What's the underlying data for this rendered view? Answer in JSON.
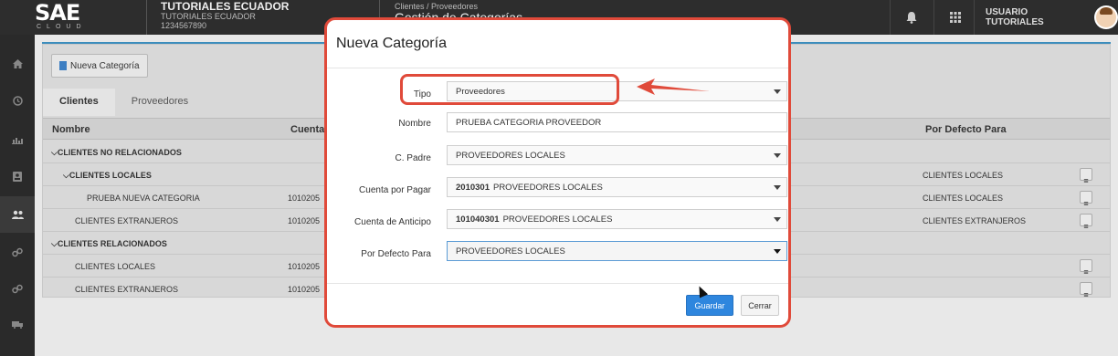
{
  "topbar": {
    "logo_main": "SAE",
    "logo_sub": "CLOUD",
    "company_name": "TUTORIALES ECUADOR",
    "company_sub": "TUTORIALES ECUADOR",
    "company_ruc": "1234567890",
    "breadcrumb": "Clientes / Proveedores",
    "page_title": "Gestión de Categorías",
    "user_name": "USUARIO TUTORIALES"
  },
  "toolbar": {
    "new_category_label": "Nueva Categoría"
  },
  "tabs": [
    {
      "label": "Clientes",
      "active": true
    },
    {
      "label": "Proveedores",
      "active": false
    }
  ],
  "table": {
    "headers": {
      "name": "Nombre",
      "account": "Cuenta",
      "default_for": "Por Defecto Para"
    },
    "rows": [
      {
        "name": "CLIENTES NO RELACIONADOS",
        "level": 0,
        "group": true,
        "account": "",
        "default_for": ""
      },
      {
        "name": "CLIENTES LOCALES",
        "level": 1,
        "group": true,
        "account": "",
        "default_for": "CLIENTES LOCALES"
      },
      {
        "name": "PRUEBA NUEVA CATEGORIA",
        "level": 2,
        "group": false,
        "account": "1010205",
        "default_for": "CLIENTES LOCALES"
      },
      {
        "name": "CLIENTES EXTRANJEROS",
        "level": 1,
        "group": false,
        "account": "1010205",
        "default_for": "CLIENTES EXTRANJEROS"
      },
      {
        "name": "CLIENTES RELACIONADOS",
        "level": 0,
        "group": true,
        "account": "",
        "default_for": ""
      },
      {
        "name": "CLIENTES LOCALES",
        "level": 1,
        "group": false,
        "account": "1010205",
        "default_for": ""
      },
      {
        "name": "CLIENTES EXTRANJEROS",
        "level": 1,
        "group": false,
        "account": "1010205",
        "default_for": ""
      }
    ]
  },
  "modal": {
    "title": "Nueva Categoría",
    "fields": {
      "tipo": {
        "label": "Tipo",
        "value": "Proveedores"
      },
      "nombre": {
        "label": "Nombre",
        "value": "PRUEBA CATEGORIA PROVEEDOR"
      },
      "padre": {
        "label": "C. Padre",
        "value": "PROVEEDORES LOCALES"
      },
      "cuenta_pagar": {
        "label": "Cuenta por Pagar",
        "code": "2010301",
        "value": "PROVEEDORES LOCALES"
      },
      "cuenta_anticipo": {
        "label": "Cuenta de Anticipo",
        "code": "101040301",
        "value": "PROVEEDORES LOCALES"
      },
      "defecto": {
        "label": "Por Defecto Para",
        "value": "PROVEEDORES LOCALES"
      }
    },
    "save_label": "Guardar",
    "close_label": "Cerrar"
  },
  "colors": {
    "accent": "#2e86de",
    "annotation": "#e04a3a",
    "topbar": "#2d2d2d"
  },
  "icons": [
    "bell-icon",
    "grid-icon",
    "home-icon",
    "clock-icon",
    "chart-icon",
    "contact-icon",
    "users-icon",
    "link-icon",
    "truck-icon",
    "menu-icon",
    "caret-down-icon"
  ]
}
